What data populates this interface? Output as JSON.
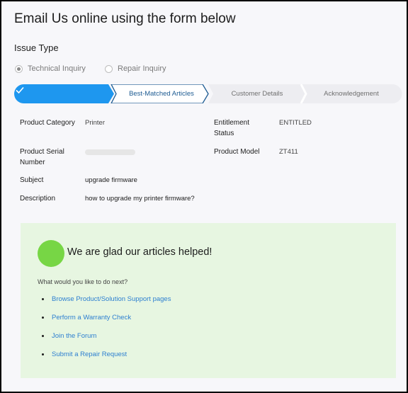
{
  "page": {
    "title": "Email Us online using the form below",
    "issue_type_label": "Issue Type"
  },
  "issue_types": [
    {
      "label": "Technical Inquiry",
      "selected": true
    },
    {
      "label": "Repair Inquiry",
      "selected": false
    }
  ],
  "stepper": {
    "steps": [
      {
        "label": "",
        "state": "completed",
        "icon": "checkmark-icon"
      },
      {
        "label": "Best-Matched Articles",
        "state": "current"
      },
      {
        "label": "Customer Details",
        "state": "upcoming"
      },
      {
        "label": "Acknowledgement",
        "state": "upcoming"
      }
    ],
    "colors": {
      "completed": "#1e97ef",
      "current_border": "#1d5b92",
      "upcoming": "#ededf1"
    }
  },
  "details": {
    "product_category_label": "Product Category",
    "product_category_value": "Printer",
    "entitlement_status_label": "Entitlement Status",
    "entitlement_status_value": "ENTITLED",
    "product_serial_label": "Product Serial Number",
    "product_serial_value": "",
    "product_model_label": "Product Model",
    "product_model_value": "ZT411",
    "subject_label": "Subject",
    "subject_value": "upgrade firmware",
    "description_label": "Description",
    "description_value": "how to upgrade my printer firmware?"
  },
  "success_panel": {
    "heading": "We are glad our articles helped!",
    "question": "What would you like to do next?",
    "links": [
      "Browse Product/Solution Support pages",
      "Perform a Warranty Check",
      "Join the Forum",
      "Submit a Repair Request"
    ],
    "accent_color": "#77d645",
    "background_color": "#e7f6e1"
  }
}
